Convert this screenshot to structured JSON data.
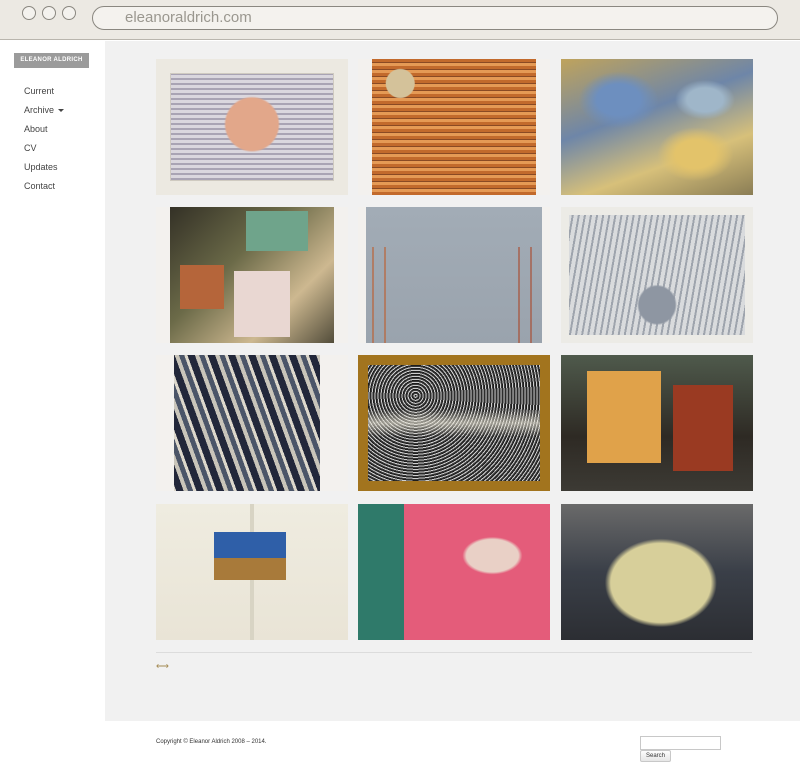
{
  "browser": {
    "url": "eleanoraldrich.com"
  },
  "sidebar": {
    "brand": "ELEANOR ALDRICH",
    "items": [
      {
        "label": "Current",
        "icon": ""
      },
      {
        "label": "Archive",
        "icon": "caret-down-icon"
      },
      {
        "label": "About",
        "icon": ""
      },
      {
        "label": "CV",
        "icon": ""
      },
      {
        "label": "Updates",
        "icon": ""
      },
      {
        "label": "Contact",
        "icon": ""
      }
    ]
  },
  "gallery": {
    "pagination_icon": "double-arrow-icon",
    "pagination_symbol": "⟷"
  },
  "footer": {
    "copyright": "Copyright © Eleanor Aldrich 2008 – 2014.",
    "search_placeholder": "",
    "search_button": "Search"
  },
  "colors": {
    "chrome_bg": "#ece9e3",
    "main_bg": "#f1f1f1",
    "brand_bg": "#9b9b9b",
    "pager_accent": "#a38a52"
  }
}
